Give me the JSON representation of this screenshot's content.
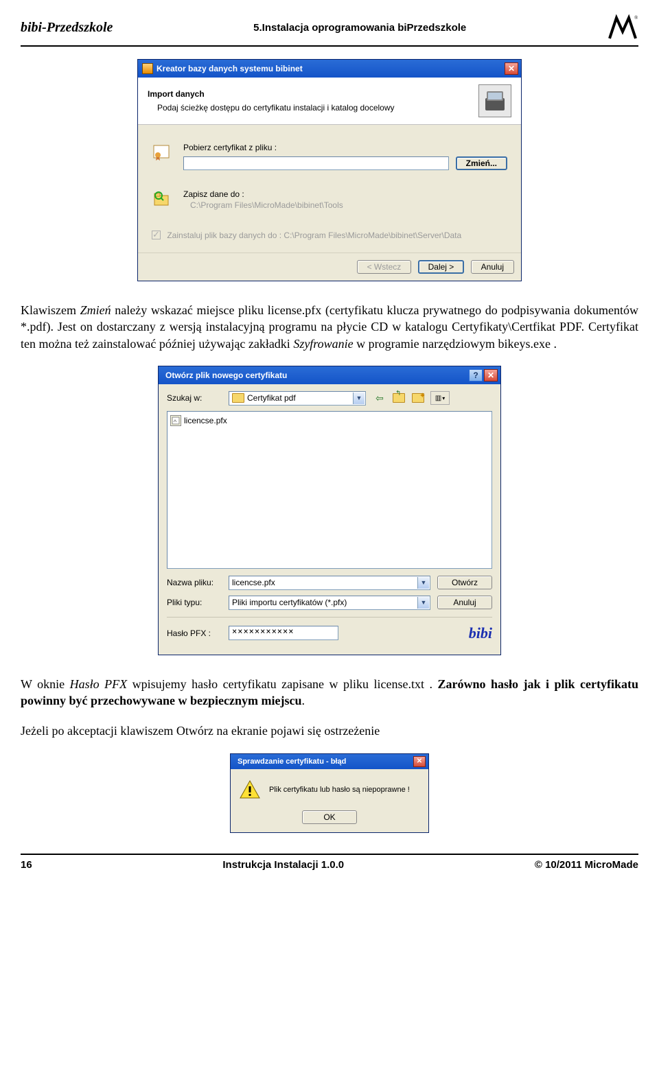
{
  "header": {
    "left": "bibi-Przedszkole",
    "center": "5.Instalacja oprogramowania biPrzedszkole"
  },
  "footer": {
    "page": "16",
    "center": "Instrukcja Instalacji   1.0.0",
    "right": "© 10/2011 MicroMade"
  },
  "para1_a": "Klawiszem ",
  "para1_zmien": "Zmień",
  "para1_b": " należy wskazać miejsce pliku license.pfx (certyfikatu klucza prywatnego do podpisywania dokumentów *.pdf). Jest on dostarczany z wersją instalacyjną programu na płycie CD w katalogu Certyfikaty\\Certfikat PDF. Certyfikat ten można też zainstalować później używając zakładki ",
  "para1_szyfr": "Szyfrowanie",
  "para1_c": " w programie narzędziowym bikeys.exe .",
  "para2_a": "W oknie ",
  "para2_haslo": "Hasło PFX",
  "para2_b": " wpisujemy hasło certyfikatu zapisane w pliku license.txt . ",
  "para2_bold": "Zarówno hasło jak i plik certyfikatu powinny być przechowywane w bezpiecznym miejscu",
  "para2_c": ".",
  "para3": "Jeżeli po akceptacji klawiszem Otwórz na ekranie pojawi się ostrzeżenie",
  "dlg1": {
    "title": "Kreator bazy danych systemu bibinet",
    "top_title": "Import danych",
    "top_sub": "Podaj ścieżkę dostępu do certyfikatu instalacji i katalog docelowy",
    "row1_label": "Pobierz certyfikat z  pliku :",
    "row1_btn": "Zmień...",
    "row2_label": "Zapisz dane do :",
    "row2_path": "C:\\Program Files\\MicroMade\\bibinet\\Tools",
    "chk_label": "Zainstaluj plik bazy danych do :  C:\\Program Files\\MicroMade\\bibinet\\Server\\Data",
    "btn_back": "< Wstecz",
    "btn_next": "Dalej >",
    "btn_cancel": "Anuluj"
  },
  "dlg2": {
    "title": "Otwórz plik nowego certyfikatu",
    "lookin_label": "Szukaj w:",
    "lookin_value": "Certyfikat pdf",
    "file_item": "licencse.pfx",
    "filename_label": "Nazwa pliku:",
    "filename_value": "licencse.pfx",
    "filetype_label": "Pliki typu:",
    "filetype_value": "Pliki importu certyfikatów (*.pfx)",
    "btn_open": "Otwórz",
    "btn_cancel": "Anuluj",
    "pw_label": "Hasło PFX :",
    "pw_value": "×××××××××××",
    "bibi": "bibi"
  },
  "dlg3": {
    "title": "Sprawdzanie certyfikatu - błąd",
    "msg": "Plik certyfikatu lub hasło są niepoprawne !",
    "btn_ok": "OK"
  }
}
